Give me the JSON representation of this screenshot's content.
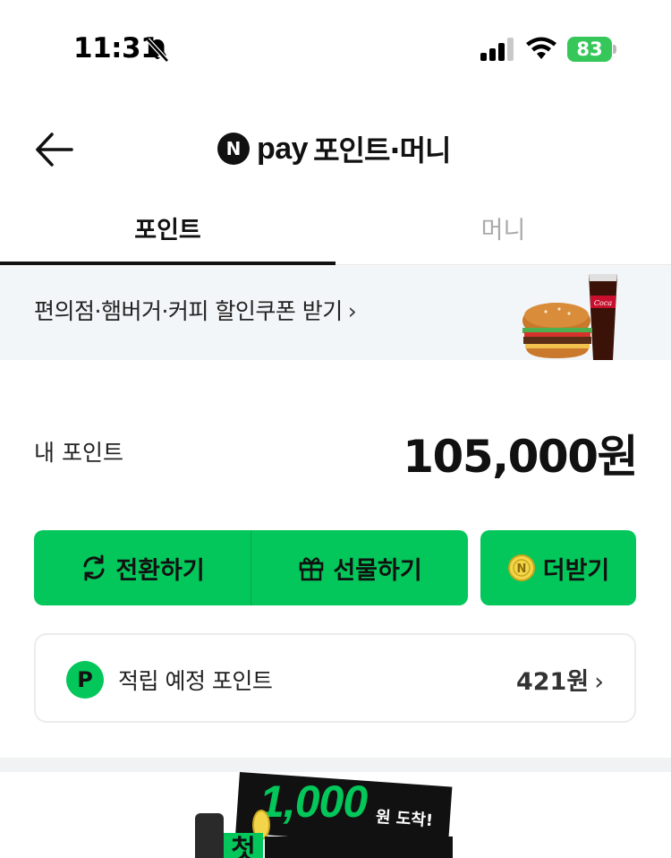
{
  "status_bar": {
    "time": "11:31",
    "battery": "83",
    "battery_color": "#35c759"
  },
  "header": {
    "back_icon": "arrow-left-icon",
    "badge": "N",
    "brand": "pay",
    "title": "포인트·머니"
  },
  "tabs": [
    {
      "label": "포인트",
      "active": true
    },
    {
      "label": "머니",
      "active": false
    }
  ],
  "banner": {
    "text": "편의점·햄버거·커피 할인쿠폰 받기",
    "chevron": "›"
  },
  "points": {
    "label": "내 포인트",
    "value": "105,000원"
  },
  "actions": {
    "convert_label": "전환하기",
    "gift_label": "선물하기",
    "more_label": "더받기",
    "accent_color": "#03c75a"
  },
  "pending": {
    "badge": "P",
    "label": "적립 예정 포인트",
    "value": "421원",
    "chevron": "›"
  },
  "promo": {
    "amount": "1,000",
    "unit": "원 도착!",
    "first_char": "첫"
  }
}
